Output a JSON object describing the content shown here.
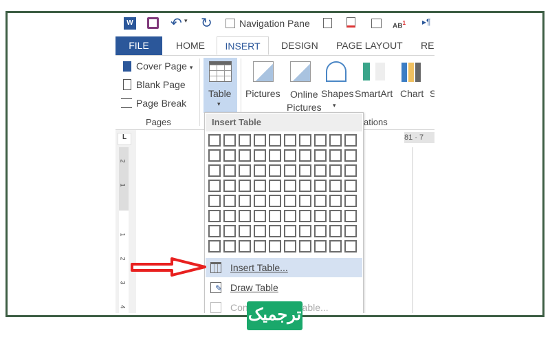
{
  "quick_access": {
    "navigation_pane_label": "Navigation Pane",
    "icons": [
      "word-icon",
      "save-icon",
      "undo-icon",
      "redo-icon",
      "checkbox-icon",
      "header-icon",
      "footer-icon",
      "new-comment-icon",
      "footnote-icon",
      "show-formatting-icon"
    ]
  },
  "tabs": [
    {
      "label": "FILE"
    },
    {
      "label": "HOME"
    },
    {
      "label": "INSERT",
      "active": true
    },
    {
      "label": "DESIGN"
    },
    {
      "label": "PAGE LAYOUT"
    },
    {
      "label": "REF"
    }
  ],
  "ribbon": {
    "pages": {
      "cover_page": "Cover Page",
      "blank_page": "Blank Page",
      "page_break": "Page Break",
      "group_label": "Pages"
    },
    "table_label": "Table",
    "pictures": "Pictures",
    "online_pictures_1": "Online",
    "online_pictures_2": "Pictures",
    "shapes": "Shapes",
    "smartart": "SmartArt",
    "chart": "Chart",
    "screenshot_partial": "S",
    "illustrations_label_partial": "ations"
  },
  "ruler": {
    "top_right": "81 · 7",
    "left_marks": [
      "2",
      "1",
      "1",
      "2",
      "3",
      "4"
    ]
  },
  "menu": {
    "header": "Insert Table",
    "grid_rows": 8,
    "grid_cols": 10,
    "items": [
      {
        "label": "Insert Table...",
        "highlighted": true
      },
      {
        "label": "Draw Table"
      },
      {
        "label": "Convert Text to Table...",
        "disabled": true
      }
    ]
  },
  "logo_text": "ترجمیک",
  "colors": {
    "file_tab": "#2b579a",
    "frame": "#3d5e44",
    "arrow": "#e8201f",
    "highlight": "#d5e1f2",
    "logo": "#1aa86b"
  }
}
